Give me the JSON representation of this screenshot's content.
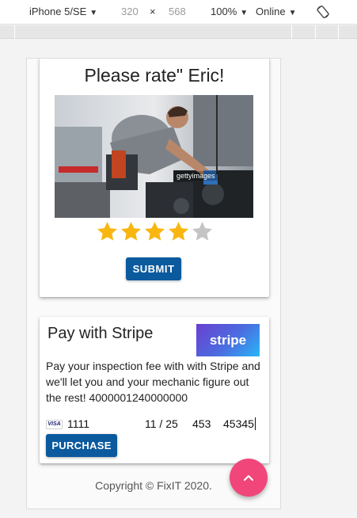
{
  "toolbar": {
    "device": "iPhone 5/SE",
    "width": "320",
    "times": "×",
    "height": "568",
    "zoom": "100%",
    "network": "Online"
  },
  "rating": {
    "title": "Please rate\" Eric!",
    "image_watermark": "gettyimages",
    "stars_filled": 4,
    "stars_total": 5,
    "submit_label": "SUBMIT"
  },
  "stripe": {
    "title": "Pay with Stripe",
    "logo_text": "stripe",
    "description": "Pay your inspection fee with with Stripe and we'll let you and your mechanic figure out the rest! 4000001240000000",
    "card_brand": "VISA",
    "card_number": "1111",
    "expiry": "11 / 25",
    "cvc": "453",
    "zip": "45345",
    "purchase_label": "PURCHASE"
  },
  "footer": {
    "copyright": "Copyright © FixIT 2020."
  },
  "colors": {
    "primary_button": "#0b5a9e",
    "star_filled": "#f9b611",
    "star_empty": "#c4c4c4",
    "fab": "#f0467a"
  },
  "icons": {
    "device_dropdown": "caret-down-icon",
    "rotate": "rotate-device-icon",
    "card_brand": "visa-icon",
    "fab": "chevron-up-icon"
  }
}
